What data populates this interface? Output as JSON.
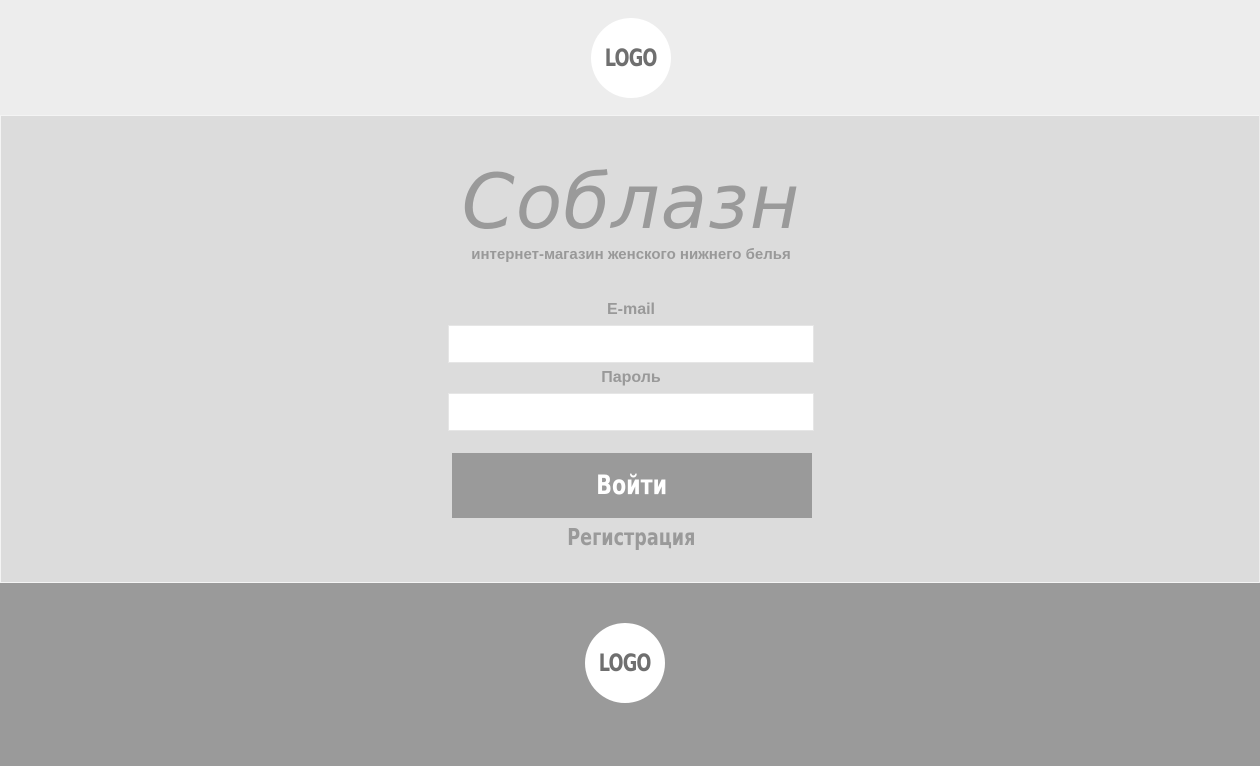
{
  "header": {
    "logo_text": "LOGO"
  },
  "main": {
    "brand_title": "Соблазн",
    "tagline": "интернет-магазин женского нижнего белья",
    "email_label": "E-mail",
    "email_value": "",
    "password_label": "Пароль",
    "password_value": "",
    "login_label": "Войти",
    "register_label": "Регистрация"
  },
  "footer": {
    "logo_text": "LOGO"
  },
  "colors": {
    "header_bg": "#ededed",
    "main_bg": "#dcdcdc",
    "footer_bg": "#9a9a9a",
    "accent_gray": "#9a9a9a",
    "input_bg": "#ffffff"
  }
}
